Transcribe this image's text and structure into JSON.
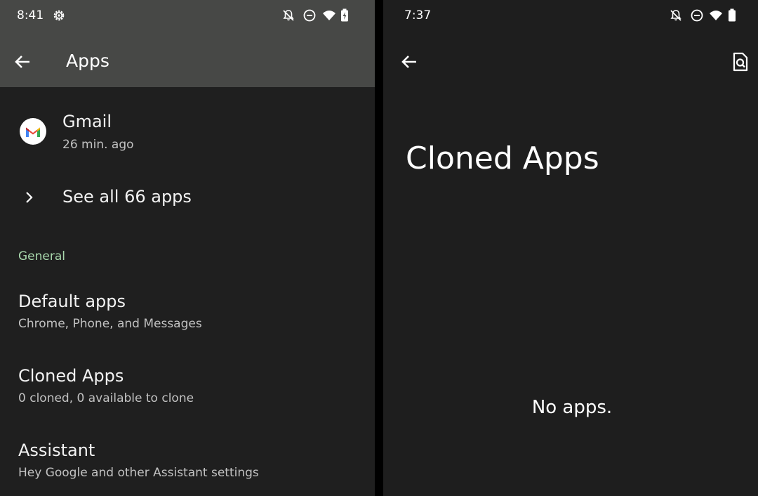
{
  "left": {
    "status_time": "8:41",
    "title": "Apps",
    "recent_app": {
      "name": "Gmail",
      "time": "26 min. ago",
      "icon": "gmail-icon"
    },
    "see_all_label": "See all 66 apps",
    "section_general": "General",
    "items": [
      {
        "title": "Default apps",
        "subtitle": "Chrome, Phone, and Messages"
      },
      {
        "title": "Cloned Apps",
        "subtitle": "0 cloned, 0 available to clone"
      },
      {
        "title": "Assistant",
        "subtitle": "Hey Google and other Assistant settings"
      }
    ]
  },
  "right": {
    "status_time": "7:37",
    "title": "Cloned Apps",
    "empty_message": "No apps."
  },
  "colors": {
    "background": "#1f1f1f",
    "appbar": "#474846",
    "section_accent": "#a9d8ad",
    "text_primary": "#ffffff",
    "text_secondary": "#c2c2c2"
  }
}
